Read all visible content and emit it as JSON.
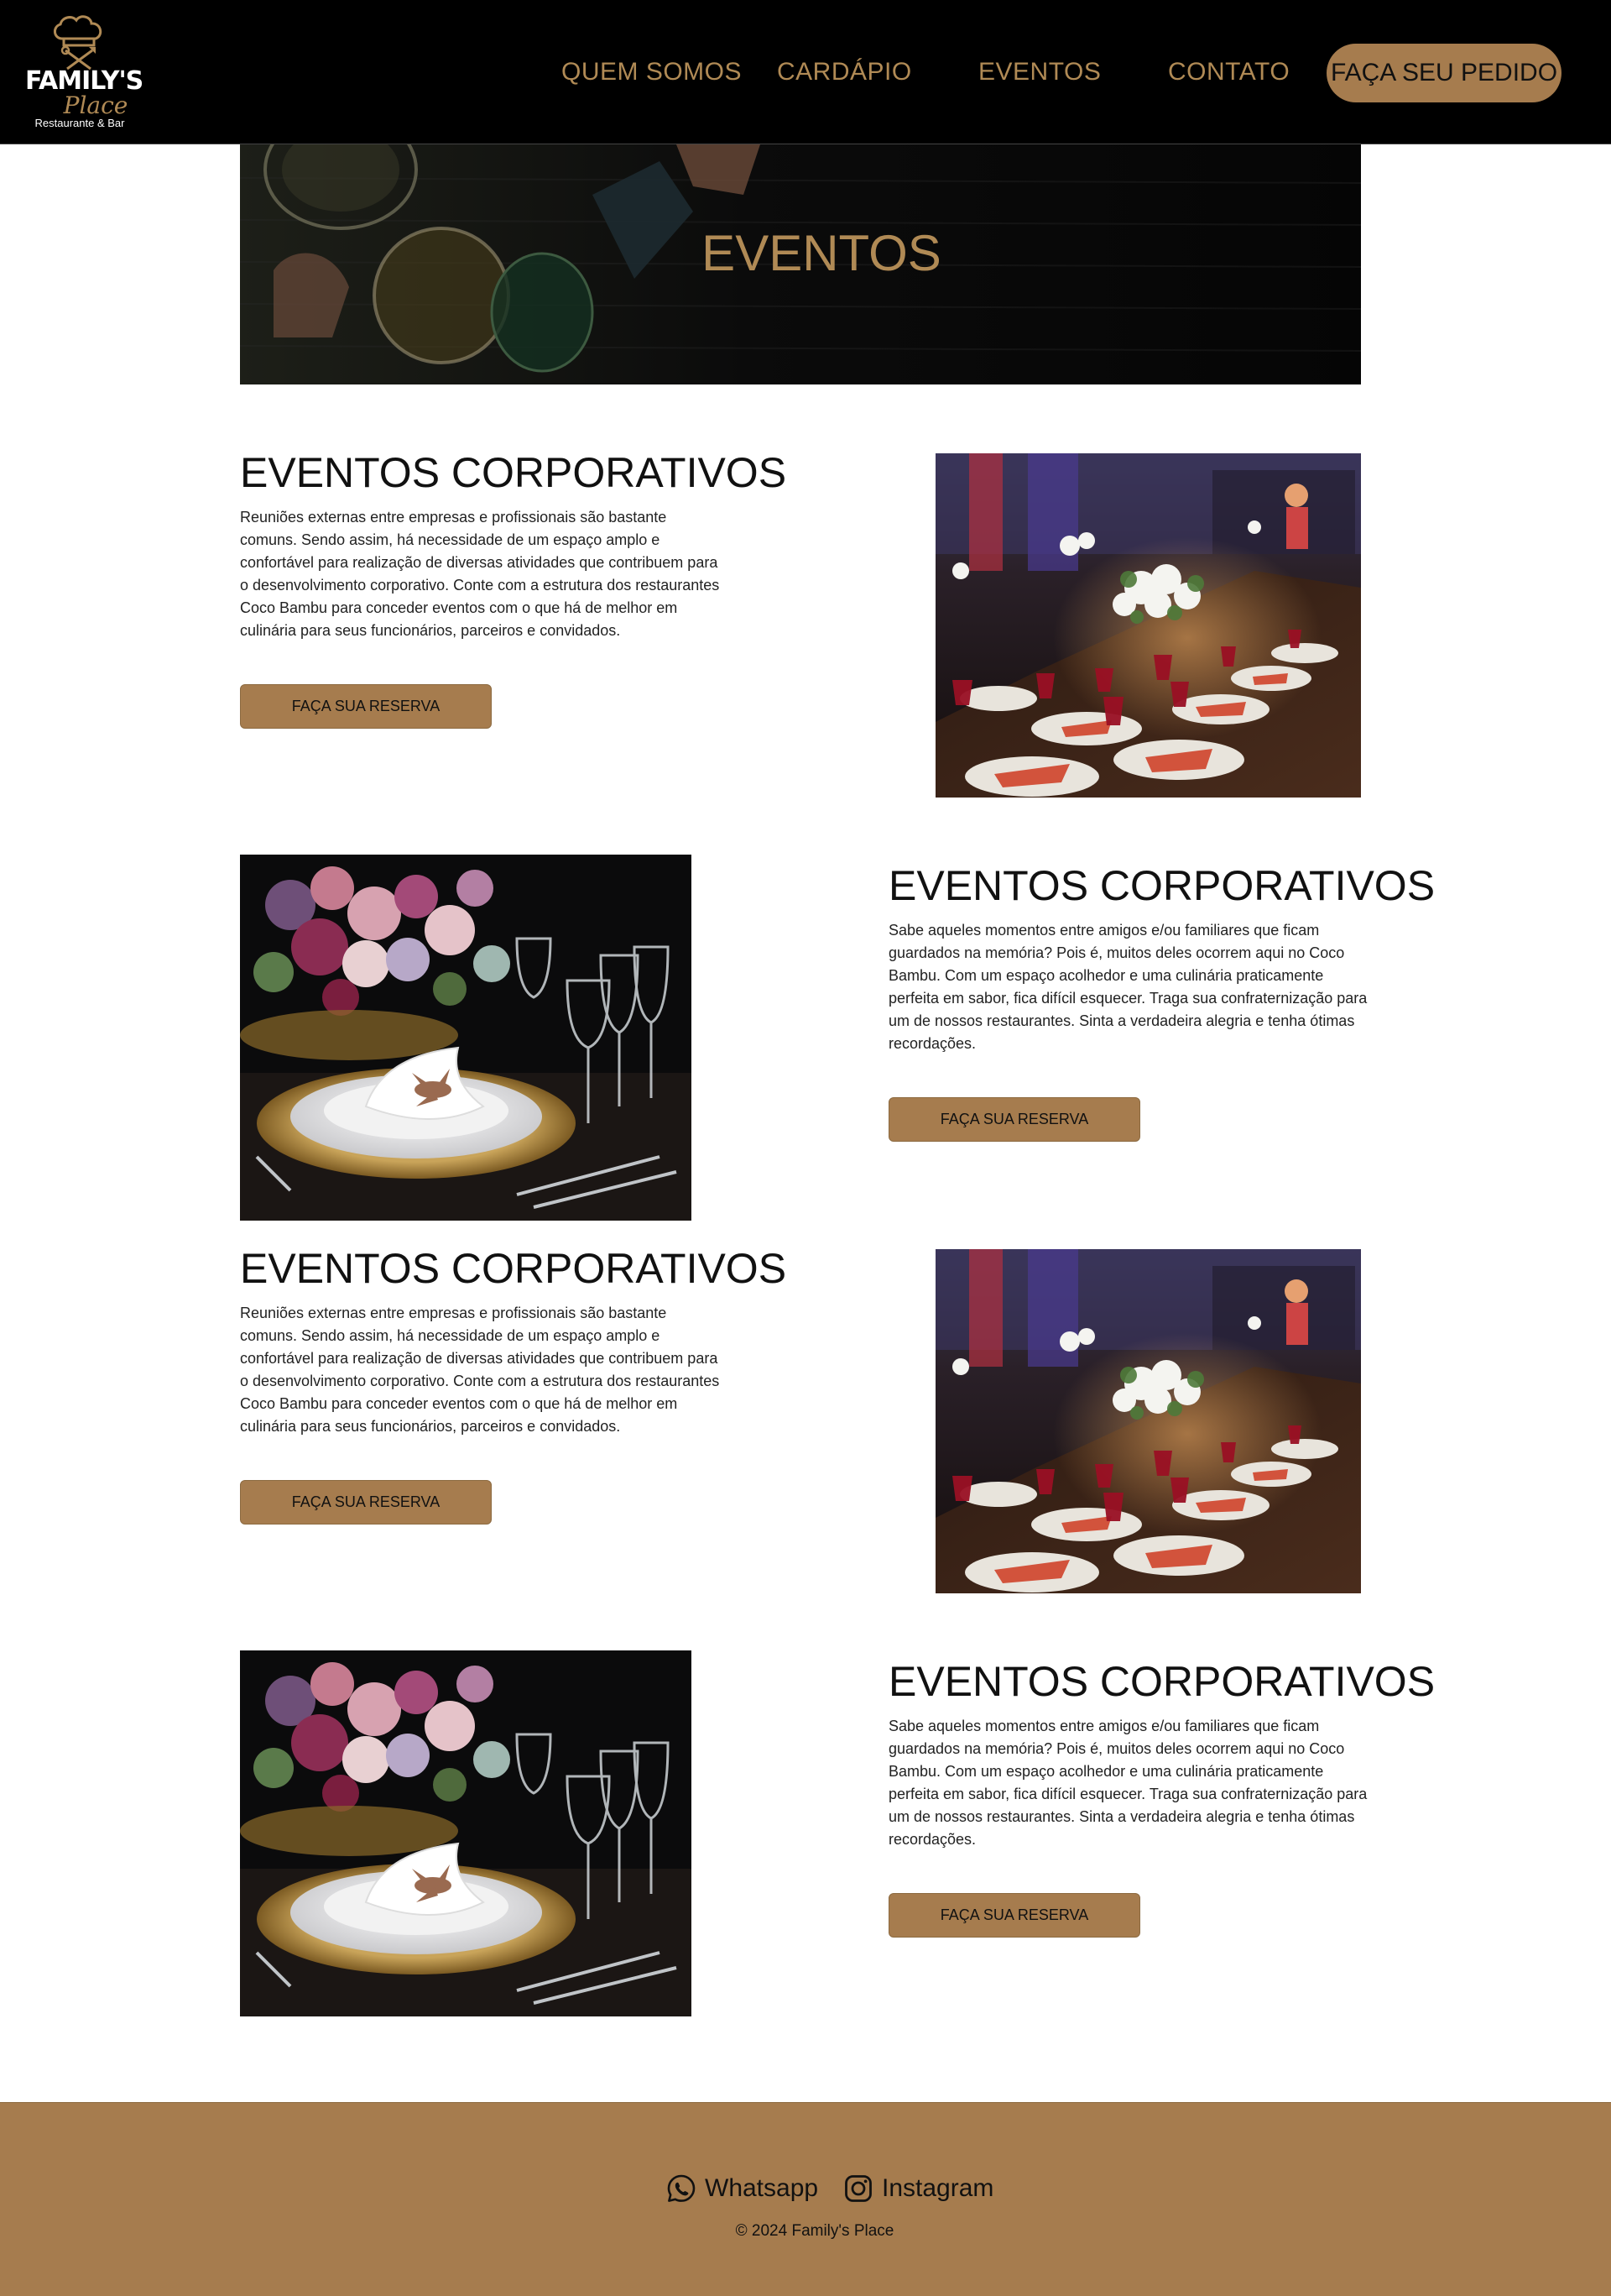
{
  "brand": {
    "name": "FAMILY'S",
    "name_script": "Place",
    "tagline": "Restaurante & Bar",
    "accent_color": "#a67c4e",
    "text_gold": "#b08a55"
  },
  "nav": {
    "items": [
      "QUEM SOMOS",
      "CARDÁPIO",
      "EVENTOS",
      "CONTATO"
    ],
    "cta": "FAÇA SEU PEDIDO"
  },
  "hero": {
    "title": "EVENTOS"
  },
  "sections": [
    {
      "title": "EVENTOS CORPORATIVOS",
      "text": "Reuniões externas entre empresas e profissionais são bastante comuns. Sendo assim, há necessidade de um espaço amplo e confortável para realização de diversas atividades que contribuem para o desenvolvimento corporativo. Conte com a estrutura dos restaurantes Coco Bambu para conceder eventos com o que há de melhor em culinária para seus funcionários, parceiros e convidados.",
      "button": "FAÇA SUA RESERVA",
      "image": "restaurant-long-table-photo"
    },
    {
      "title": "EVENTOS CORPORATIVOS",
      "text": "Sabe aqueles momentos entre amigos e/ou familiares que ficam guardados na memória? Pois é, muitos deles ocorrem aqui no Coco Bambu. Com um espaço acolhedor e uma culinária praticamente perfeita em sabor, fica difícil esquecer. Traga sua confraternização para um de nossos restaurantes. Sinta a verdadeira alegria e tenha ótimas recordações.",
      "button": "FAÇA SUA RESERVA",
      "image": "place-setting-flowers-photo"
    },
    {
      "title": "EVENTOS CORPORATIVOS",
      "text": "Reuniões externas entre empresas e profissionais são bastante comuns. Sendo assim, há necessidade de um espaço amplo e confortável para realização de diversas atividades que contribuem para o desenvolvimento corporativo. Conte com a estrutura dos restaurantes Coco Bambu para conceder eventos com o que há de melhor em culinária para seus funcionários, parceiros e convidados.",
      "button": "FAÇA SUA RESERVA",
      "image": "restaurant-long-table-photo"
    },
    {
      "title": "EVENTOS CORPORATIVOS",
      "text": "Sabe aqueles momentos entre amigos e/ou familiares que ficam guardados na memória? Pois é, muitos deles ocorrem aqui no Coco Bambu. Com um espaço acolhedor e uma culinária praticamente perfeita em sabor, fica difícil esquecer. Traga sua confraternização para um de nossos restaurantes. Sinta a verdadeira alegria e tenha ótimas recordações.",
      "button": "FAÇA SUA RESERVA",
      "image": "place-setting-flowers-photo"
    }
  ],
  "footer": {
    "whatsapp": "Whatsapp",
    "instagram": "Instagram",
    "copyright": "© 2024 Family's Place"
  }
}
